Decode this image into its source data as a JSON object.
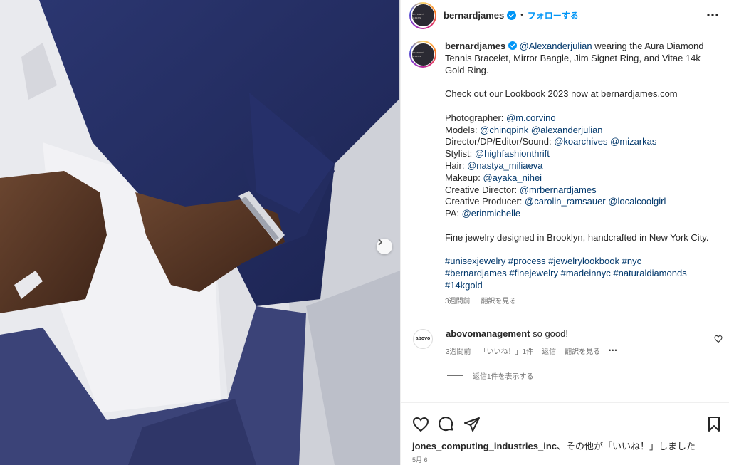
{
  "header": {
    "username": "bernardjames",
    "avatar_text": "bernard james",
    "separator": "•",
    "follow_label": "フォローする"
  },
  "caption": {
    "username": "bernardjames",
    "mention_main": "@Alexanderjulian",
    "intro": " wearing the Aura Diamond Tennis Bracelet, Mirror Bangle, Jim Signet Ring, and Vitae 14k Gold Ring.",
    "lookbook": "Check out our Lookbook 2023 now at bernardjames.com",
    "credits": [
      {
        "label": "Photographer: ",
        "mentions": [
          "@m.corvino"
        ]
      },
      {
        "label": "Models: ",
        "mentions": [
          "@chinqpink",
          "@alexanderjulian"
        ]
      },
      {
        "label": "Director/DP/Editor/Sound: ",
        "mentions": [
          "@koarchives",
          "@mizarkas"
        ]
      },
      {
        "label": "Stylist: ",
        "mentions": [
          "@highfashionthrift"
        ]
      },
      {
        "label": "Hair: ",
        "mentions": [
          "@nastya_miliaeva"
        ]
      },
      {
        "label": "Makeup: ",
        "mentions": [
          "@ayaka_nihei"
        ]
      },
      {
        "label": "Creative Director: ",
        "mentions": [
          "@mrbernardjames"
        ]
      },
      {
        "label": "Creative Producer: ",
        "mentions": [
          "@carolin_ramsauer",
          "@localcoolgirl"
        ]
      },
      {
        "label": "PA: ",
        "mentions": [
          "@erinmichelle"
        ]
      }
    ],
    "fine_jewelry": "Fine jewelry designed in Brooklyn, handcrafted in New York City.",
    "hashtags": [
      "#unisexjewelry",
      "#process",
      "#jewelrylookbook",
      "#nyc",
      "#bernardjames",
      "#finejewelry",
      "#madeinnyc",
      "#naturaldiamonds",
      "#14kgold"
    ],
    "time": "3週間前",
    "translate": "翻訳を見る"
  },
  "comment": {
    "avatar_text": "abovo",
    "username": "abovomanagement",
    "text": " so good!",
    "time": "3週間前",
    "likes": "「いいね！」1件",
    "reply": "返信",
    "translate": "翻訳を見る",
    "more": "•••",
    "view_replies": "返信1件を表示する"
  },
  "footer": {
    "liked_by_user": "jones_computing_industries_inc",
    "liked_by_rest": "、その他が「いいね！」しました",
    "date": "5月 6"
  },
  "colors": {
    "link": "#00376b",
    "follow": "#0095f6",
    "verified": "#0095f6",
    "muted": "#737373"
  }
}
